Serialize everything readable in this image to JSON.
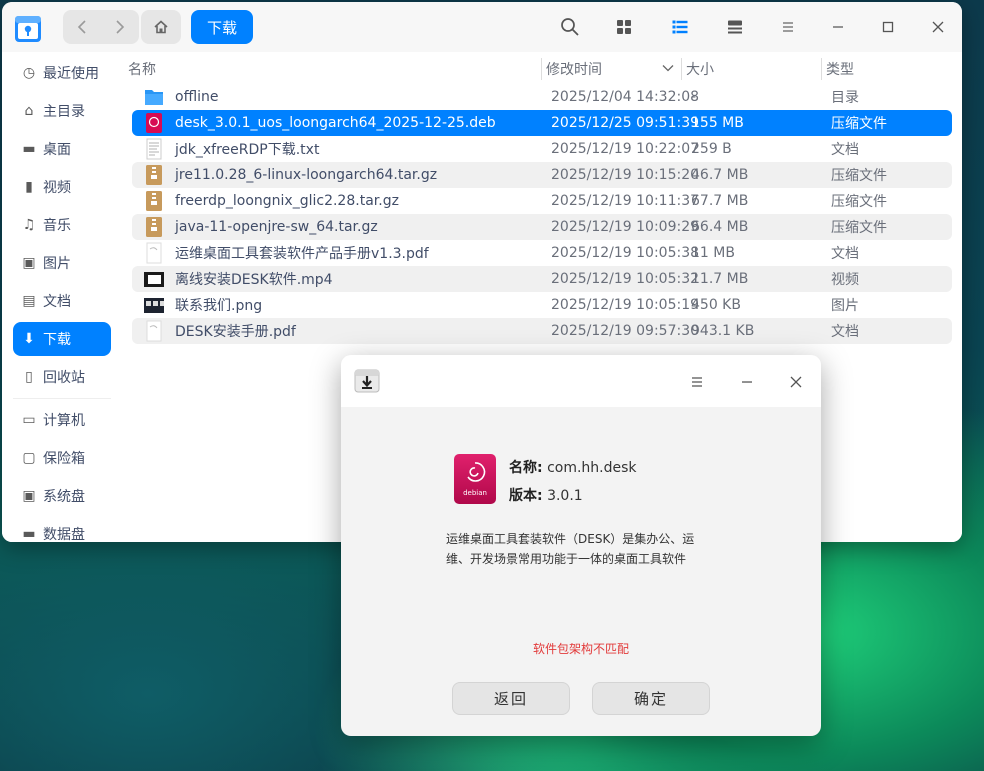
{
  "file_manager": {
    "toolbar": {
      "current_folder": "下载"
    },
    "sidebar": {
      "items": [
        {
          "label": "最近使用",
          "icon": "clock-icon"
        },
        {
          "label": "主目录",
          "icon": "home-icon"
        },
        {
          "label": "桌面",
          "icon": "desktop-icon"
        },
        {
          "label": "视频",
          "icon": "video-icon"
        },
        {
          "label": "音乐",
          "icon": "music-icon"
        },
        {
          "label": "图片",
          "icon": "picture-icon"
        },
        {
          "label": "文档",
          "icon": "document-icon"
        },
        {
          "label": "下载",
          "icon": "download-icon",
          "active": true
        },
        {
          "label": "回收站",
          "icon": "trash-icon"
        },
        {
          "label": "计算机",
          "icon": "computer-icon"
        },
        {
          "label": "保险箱",
          "icon": "vault-icon"
        },
        {
          "label": "系统盘",
          "icon": "disk-icon"
        },
        {
          "label": "数据盘",
          "icon": "disk-icon"
        }
      ]
    },
    "columns": {
      "name": "名称",
      "modified": "修改时间",
      "size": "大小",
      "type": "类型"
    },
    "files": [
      {
        "name": "offline",
        "time": "2025/12/04 14:32:08",
        "size": "-",
        "type": "目录",
        "icon": "folder-icon"
      },
      {
        "name": "desk_3.0.1_uos_loongarch64_2025-12-25.deb",
        "time": "2025/12/25 09:51:39",
        "size": "155 MB",
        "type": "压缩文件",
        "icon": "deb-package-icon",
        "selected": true
      },
      {
        "name": "jdk_xfreeRDP下载.txt",
        "time": "2025/12/19 10:22:07",
        "size": "259 B",
        "type": "文档",
        "icon": "text-file-icon"
      },
      {
        "name": "jre11.0.28_6-linux-loongarch64.tar.gz",
        "time": "2025/12/19 10:15:20",
        "size": "46.7 MB",
        "type": "压缩文件",
        "icon": "archive-icon"
      },
      {
        "name": "freerdp_loongnix_glic2.28.tar.gz",
        "time": "2025/12/19 10:11:37",
        "size": "67.7 MB",
        "type": "压缩文件",
        "icon": "archive-icon"
      },
      {
        "name": "java-11-openjre-sw_64.tar.gz",
        "time": "2025/12/19 10:09:29",
        "size": "66.4 MB",
        "type": "压缩文件",
        "icon": "archive-icon"
      },
      {
        "name": "运维桌面工具套装软件产品手册v1.3.pdf",
        "time": "2025/12/19 10:05:38",
        "size": "11 MB",
        "type": "文档",
        "icon": "pdf-icon"
      },
      {
        "name": "离线安装DESK软件.mp4",
        "time": "2025/12/19 10:05:32",
        "size": "11.7 MB",
        "type": "视频",
        "icon": "video-thumb-icon"
      },
      {
        "name": "联系我们.png",
        "time": "2025/12/19 10:05:19",
        "size": "450 KB",
        "type": "图片",
        "icon": "image-thumb-icon"
      },
      {
        "name": "DESK安装手册.pdf",
        "time": "2025/12/19 09:57:30",
        "size": "943.1 KB",
        "type": "文档",
        "icon": "pdf-icon"
      }
    ]
  },
  "installer": {
    "name_label": "名称:",
    "name_value": "com.hh.desk",
    "version_label": "版本:",
    "version_value": "3.0.1",
    "package_icon_text": "debian",
    "description": "运维桌面工具套装软件（DESK）是集办公、运维、开发场景常用功能于一体的桌面工具软件",
    "error": "软件包架构不匹配",
    "back_button": "返回",
    "confirm_button": "确定",
    "error_color": "#e23a3a"
  },
  "colors": {
    "accent": "#0081ff"
  }
}
